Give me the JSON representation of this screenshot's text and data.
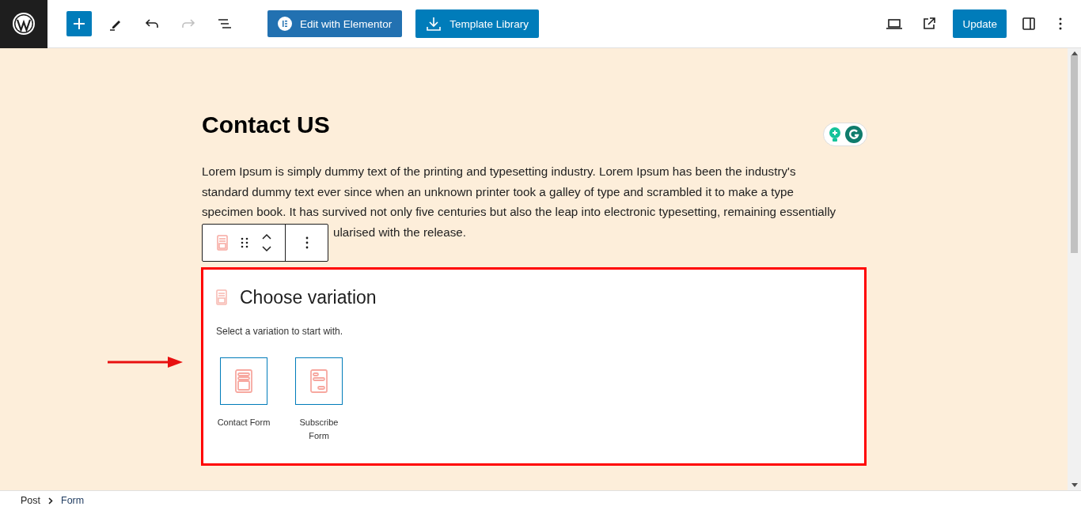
{
  "toolbar": {
    "edit_elementor": "Edit with Elementor",
    "template_library": "Template Library",
    "update": "Update",
    "redo_disabled": true
  },
  "post": {
    "title": "Contact US",
    "paragraph_lines": [
      "Lorem Ipsum is simply dummy text of the printing and typesetting industry. Lorem Ipsum has been the industry's",
      "standard dummy text ever since when an unknown printer took a galley of type and scrambled it to make a type",
      "specimen book. It has survived not only five centuries but also the leap into electronic typesetting, remaining essentially"
    ],
    "paragraph_tail": "ularised with the release."
  },
  "block": {
    "title": "Choose variation",
    "instructions": "Select a variation to start with.",
    "variations": [
      {
        "kind": "contact",
        "label": "Contact Form"
      },
      {
        "kind": "subscribe",
        "label": "Subscribe Form"
      }
    ]
  },
  "breadcrumbs": [
    {
      "label": "Post"
    },
    {
      "label": "Form"
    }
  ]
}
